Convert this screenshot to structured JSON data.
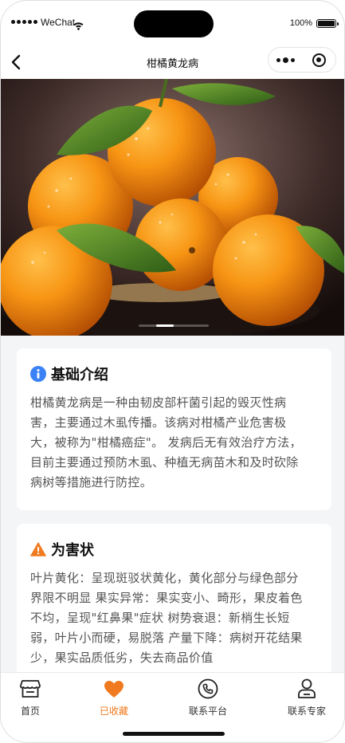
{
  "status_bar": {
    "carrier": "WeChat",
    "battery_text": "100%",
    "battery_level": 1.0,
    "icons": [
      "signal-dots-icon",
      "wifi-icon",
      "battery-icon"
    ]
  },
  "nav": {
    "title": "柑橘黄龙病",
    "back_icon": "chevron-left-icon",
    "capsule_icons": [
      "more-dots-icon",
      "close-target-icon"
    ]
  },
  "banner": {
    "image": "oranges-with-leaves-photo",
    "slide_count": 4,
    "active_slide": 2
  },
  "intro": {
    "icon": "info-icon",
    "icon_color": "#3b82f6",
    "title": "基础介绍",
    "lines": [
      "柑橘黄龙病是一种由韧皮部杆菌引起的毁灭性病",
      "害，主要通过木虱传播。该病对柑橘产业危害极",
      "大，被称为\"柑橘癌症\"。 发病后无有效治疗方法，",
      "目前主要通过预防木虱、种植无病苗木和及时砍除",
      "病树等措施进行防控。"
    ]
  },
  "hazard": {
    "icon": "warning-icon",
    "icon_color": "#f07a1f",
    "title": "为害状",
    "lines": [
      "叶片黄化：呈现斑驳状黄化，黄化部分与绿色部分",
      "界限不明显 果实异常：果实变小、畸形，果皮着色",
      "不均，呈现\"红鼻果\"症状 树势衰退：新梢生长短",
      "弱，叶片小而硬，易脱落 产量下降：病树开花结果",
      "少，果实品质低劣，失去商品价值"
    ]
  },
  "tabs": [
    {
      "label": "首页",
      "icon": "store-icon",
      "active": false
    },
    {
      "label": "已收藏",
      "icon": "heart-icon",
      "active": true
    },
    {
      "label": "联系平台",
      "icon": "phone-icon",
      "active": false
    },
    {
      "label": "联系专家",
      "icon": "expert-icon",
      "active": false
    }
  ],
  "colors": {
    "accent": "#f07a1f",
    "info_blue": "#3b82f6",
    "text": "#555555",
    "background": "#f4f5f7"
  }
}
